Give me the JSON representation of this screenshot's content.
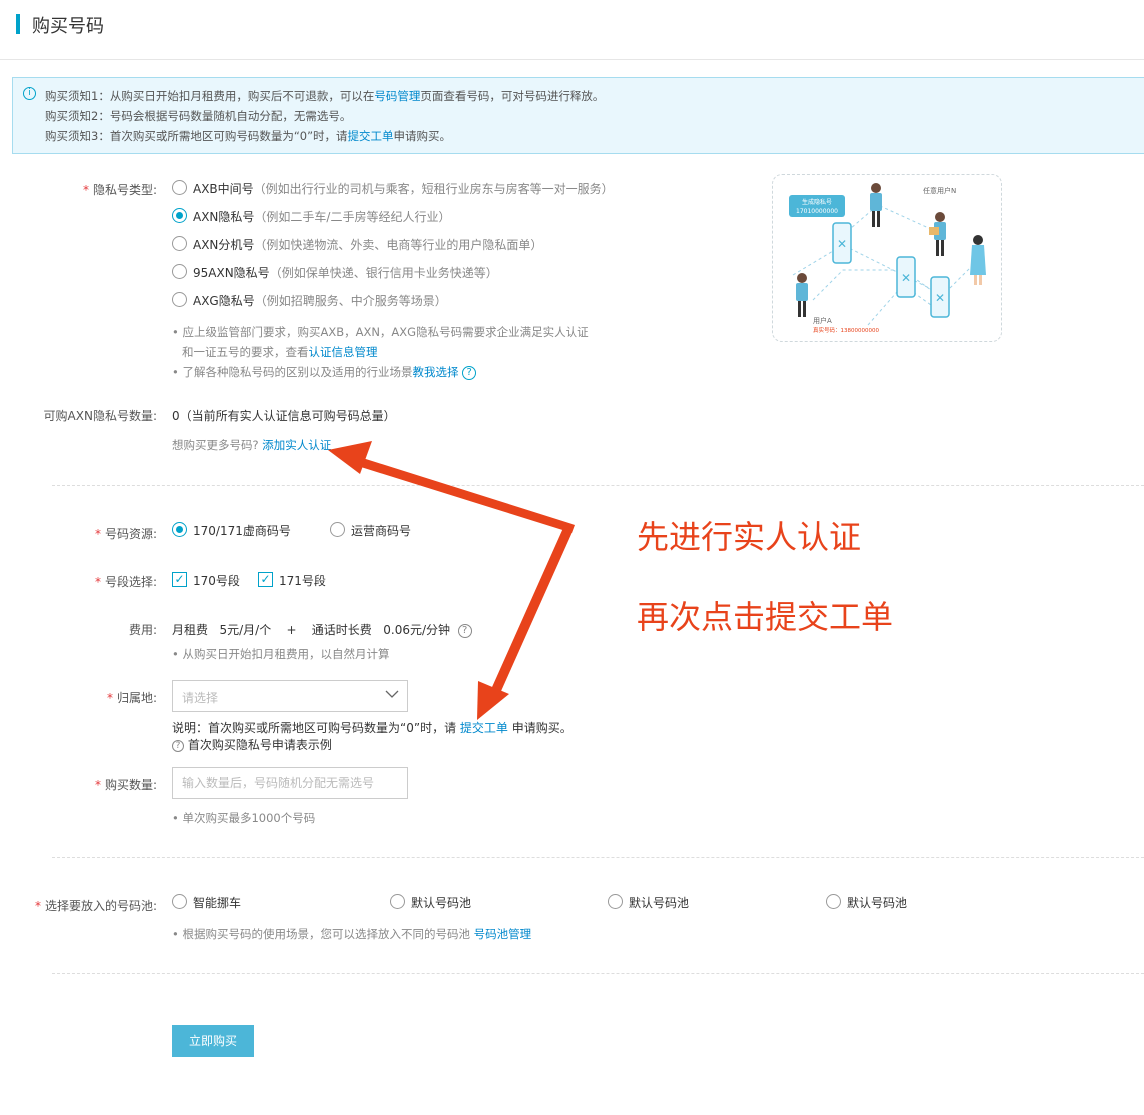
{
  "header": {
    "title": "购买号码"
  },
  "notice": {
    "line1_pre": "购买须知1：从购买日开始扣月租费用，购买后不可退款，可以在",
    "line1_link": "号码管理",
    "line1_post": "页面查看号码，可对号码进行释放。",
    "line2": "购买须知2：号码会根据号码数量随机自动分配，无需选号。",
    "line3_pre": "购买须知3：首次购买或所需地区可购号码数量为“0”时，请",
    "line3_link": "提交工单",
    "line3_post": "申请购买。"
  },
  "privacy_type": {
    "label": "隐私号类型:",
    "options": [
      {
        "name": "AXB中间号",
        "desc": "（例如出行行业的司机与乘客，短租行业房东与房客等一对一服务）",
        "selected": false
      },
      {
        "name": "AXN隐私号",
        "desc": "（例如二手车/二手房等经纪人行业）",
        "selected": true
      },
      {
        "name": "AXN分机号",
        "desc": "（例如快递物流、外卖、电商等行业的用户隐私面单）",
        "selected": false
      },
      {
        "name": "95AXN隐私号",
        "desc": "（例如保单快递、银行信用卡业务快递等）",
        "selected": false
      },
      {
        "name": "AXG隐私号",
        "desc": "（例如招聘服务、中介服务等场景）",
        "selected": false
      }
    ],
    "note1_line1": "应上级监管部门要求，购买AXB，AXN，AXG隐私号码需要求企业满足实人认证",
    "note1_line2_pre": "和一证五号的要求，查看",
    "note1_link": "认证信息管理",
    "note2_pre": "了解各种隐私号码的区别以及适用的行业场景",
    "note2_link": "教我选择"
  },
  "illustration": {
    "bubble_title": "生成隐私号",
    "bubble_number": "17010000000",
    "user_n": "任意用户N",
    "user_a": "用户A",
    "real_number": "真实号码：13800000000"
  },
  "quota": {
    "label": "可购AXN隐私号数量:",
    "value": "0（当前所有实人认证信息可购号码总量）",
    "more_pre": "想购买更多号码?",
    "more_link": "添加实人认证"
  },
  "resource": {
    "label": "号码资源:",
    "options": [
      {
        "name": "170/171虚商码号",
        "selected": true
      },
      {
        "name": "运营商码号",
        "selected": false
      }
    ]
  },
  "segment": {
    "label": "号段选择:",
    "options": [
      {
        "name": "170号段",
        "checked": true
      },
      {
        "name": "171号段",
        "checked": true
      }
    ]
  },
  "fee": {
    "label": "费用:",
    "monthly_label": "月租费",
    "monthly_value": "5元/月/个",
    "plus": "+",
    "call_label": "通话时长费",
    "call_value": "0.06元/分钟",
    "note": "从购买日开始扣月租费用，以自然月计算"
  },
  "location": {
    "label": "归属地:",
    "placeholder": "请选择",
    "note_pre": "说明：首次购买或所需地区可购号码数量为“0”时，请",
    "note_link": "提交工单",
    "note_post": "申请购买。",
    "example": "首次购买隐私号申请表示例"
  },
  "quantity": {
    "label": "购买数量:",
    "placeholder": "输入数量后，号码随机分配无需选号",
    "note": "单次购买最多1000个号码"
  },
  "pool": {
    "label": "选择要放入的号码池:",
    "options": [
      "智能挪车",
      "默认号码池",
      "默认号码池",
      "默认号码池"
    ],
    "note_pre": "根据购买号码的使用场景，您可以选择放入不同的号码池",
    "note_link": "号码池管理"
  },
  "buy_button": "立即购买",
  "annotation": {
    "line1": "先进行实人认证",
    "line2": "再次点击提交工单",
    "color": "#e8431b"
  }
}
